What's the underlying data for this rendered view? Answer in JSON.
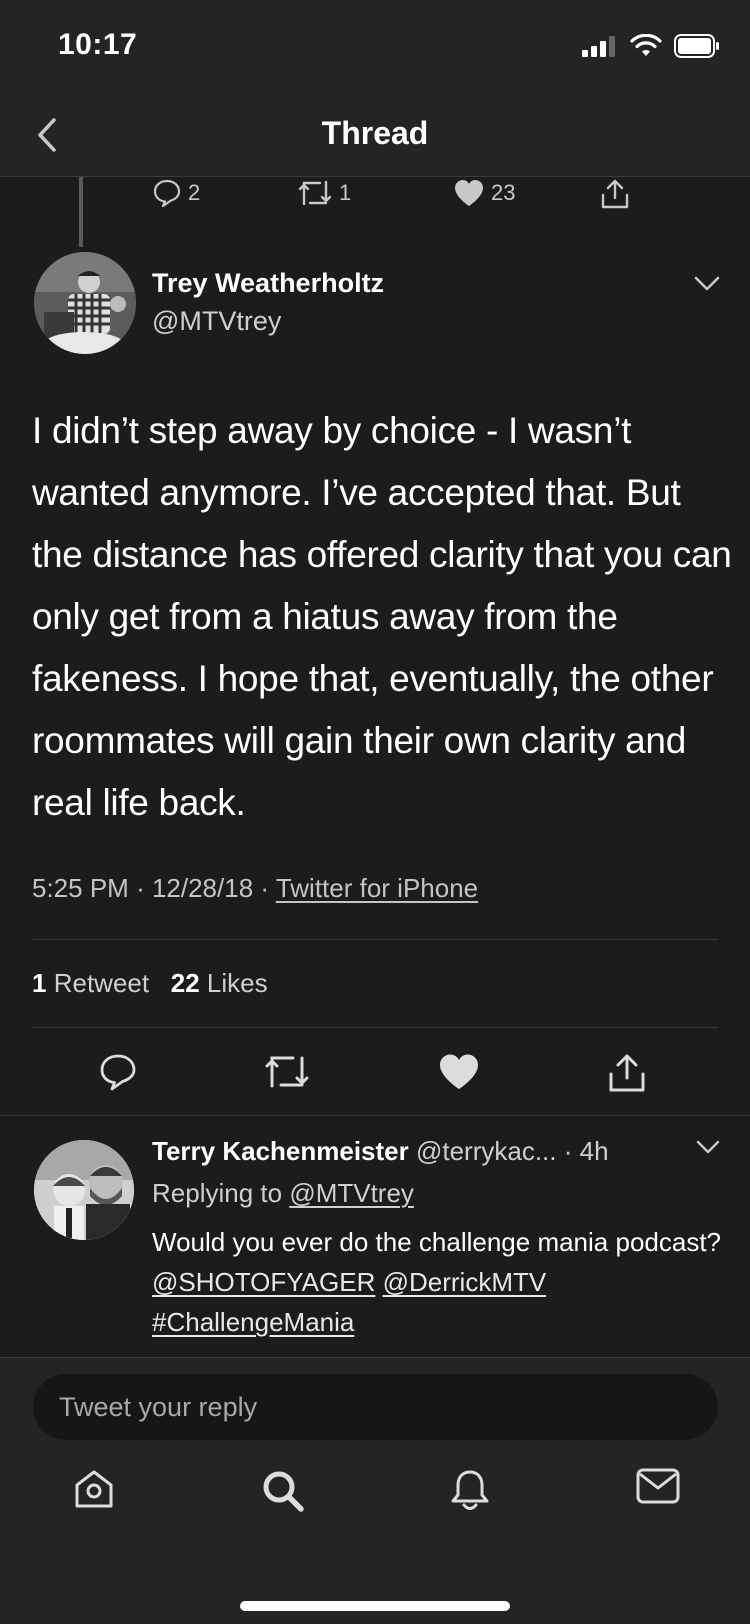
{
  "status_bar": {
    "time": "10:17",
    "icons": [
      "signal-icon",
      "wifi-icon",
      "battery-icon"
    ]
  },
  "nav": {
    "title": "Thread",
    "back_icon": "chevron-left-icon"
  },
  "previous_tweet_actions": {
    "reply_count": "2",
    "retweet_count": "1",
    "like_count": "23"
  },
  "tweet": {
    "author_name": "Trey Weatherholtz",
    "author_handle": "@MTVtrey",
    "text": "I didn’t step away by choice - I wasn’t wanted anymore. I’ve accepted that. But the distance has offered clarity that you can only get from a hiatus away from the fakeness. I hope that, eventually, the other roommates will gain their own clarity and real life back.",
    "time": "5:25 PM",
    "date": "12/28/18",
    "source": "Twitter for iPhone",
    "retweets_count": "1",
    "retweets_label": "Retweet",
    "likes_count": "22",
    "likes_label": "Likes"
  },
  "reply": {
    "author_name": "Terry Kachenmeister",
    "author_handle": "@terrykac...",
    "age": "4h",
    "replying_to_label": "Replying to",
    "replying_to_handle": "@MTVtrey",
    "text_prefix": "Would you ever do the challenge mania podcast?",
    "mention_1": "@SHOTOFYAGER",
    "mention_2": "@DerrickMTV",
    "hashtag": "#ChallengeMania"
  },
  "compose": {
    "placeholder": "Tweet your reply"
  },
  "tab_bar": {
    "tabs": [
      "home-icon",
      "search-icon",
      "notifications-icon",
      "messages-icon"
    ]
  },
  "colors": {
    "background": "#1c1c1c",
    "bar_background": "#242424",
    "text_primary": "#ffffff",
    "text_secondary": "#c4c4c4"
  }
}
